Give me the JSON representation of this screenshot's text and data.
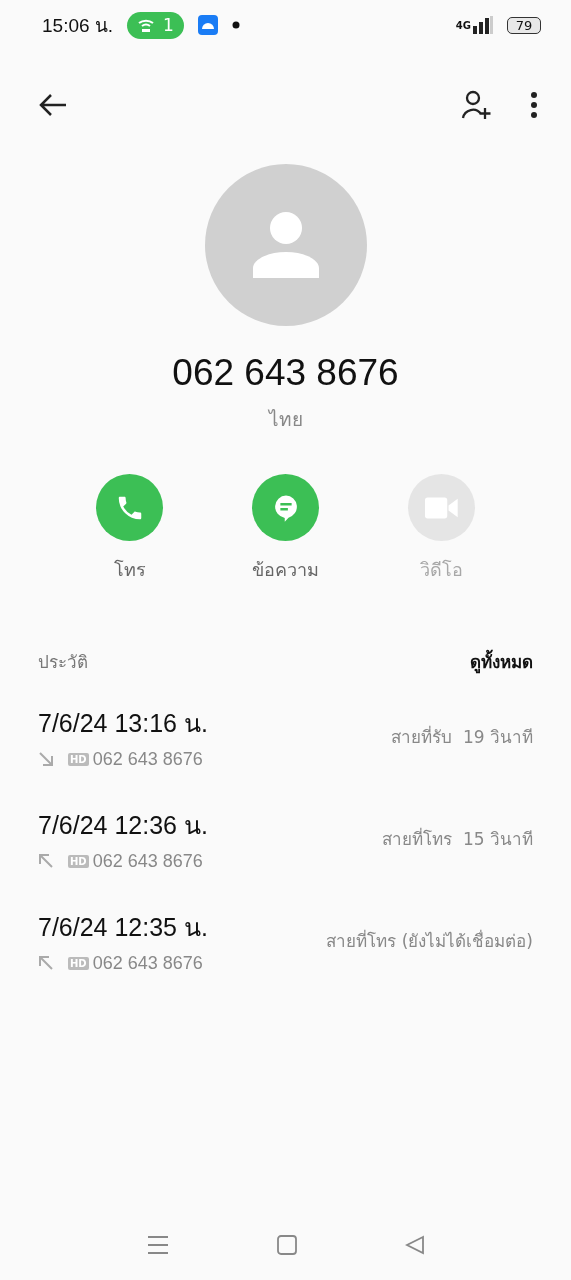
{
  "status_bar": {
    "time": "15:06 น.",
    "hotspot_count": "1",
    "network": "4G",
    "battery": "79"
  },
  "contact": {
    "number": "062 643 8676",
    "country": "ไทย"
  },
  "actions": [
    {
      "kind": "call",
      "label": "โทร",
      "disabled": false
    },
    {
      "kind": "message",
      "label": "ข้อความ",
      "disabled": false
    },
    {
      "kind": "video",
      "label": "วิดีโอ",
      "disabled": true
    }
  ],
  "history": {
    "title": "ประวัติ",
    "view_all": "ดูทั้งหมด",
    "calls": [
      {
        "datetime": "7/6/24 13:16 น.",
        "kind": "incoming",
        "hd": "HD",
        "number": "062 643 8676",
        "type": "สายที่รับ",
        "duration": "19 วินาที"
      },
      {
        "datetime": "7/6/24 12:36 น.",
        "kind": "outgoing",
        "hd": "HD",
        "number": "062 643 8676",
        "type": "สายที่โทร",
        "duration": "15 วินาที"
      },
      {
        "datetime": "7/6/24 12:35 น.",
        "kind": "outgoing",
        "hd": "HD",
        "number": "062 643 8676",
        "type": "สายที่โทร (ยังไม่ได้เชื่อมต่อ)"
      }
    ]
  }
}
